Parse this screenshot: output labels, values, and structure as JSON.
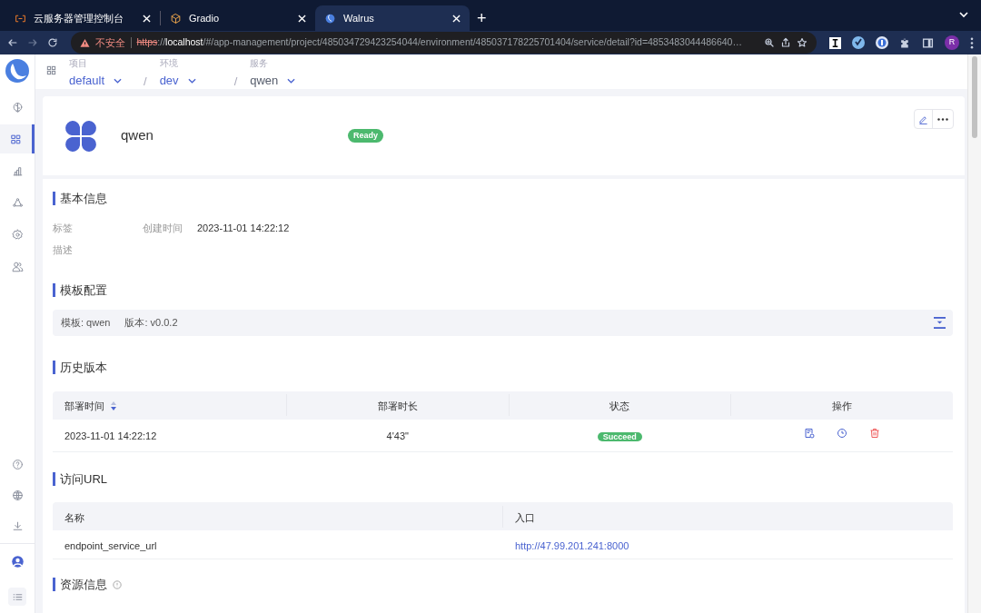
{
  "browser": {
    "tabs": [
      {
        "title": "云服务器管理控制台",
        "kind": "bracket",
        "selected": false
      },
      {
        "title": "Gradio",
        "kind": "cube",
        "selected": false
      },
      {
        "title": "Walrus",
        "kind": "moon",
        "selected": true
      }
    ],
    "new_tab": "+",
    "address": {
      "security": "不安全",
      "scheme": "https",
      "separator": "://",
      "host": "localhost",
      "path": "/#/app-management/project/485034729423254044/environment/485037178225701404/service/detail?id=4853483044486640…"
    },
    "profile": "R"
  },
  "sidebar": {
    "top_items": [
      {
        "kind": "brain",
        "selected": false
      },
      {
        "kind": "grid",
        "selected": true
      },
      {
        "kind": "chart",
        "selected": false
      },
      {
        "kind": "nodes",
        "selected": false
      },
      {
        "kind": "gear",
        "selected": false
      },
      {
        "kind": "users",
        "selected": false
      }
    ],
    "bottom_items": [
      {
        "kind": "help"
      },
      {
        "kind": "globe"
      },
      {
        "kind": "download"
      },
      {
        "kind": "avatar"
      },
      {
        "kind": "list"
      }
    ]
  },
  "breadcrumbs": [
    {
      "label": "项目",
      "value": "default",
      "current": false
    },
    {
      "label": "环境",
      "value": "dev",
      "current": false
    },
    {
      "label": "服务",
      "value": "qwen",
      "current": true
    }
  ],
  "breadcrumb_separator": "/",
  "service": {
    "name": "qwen",
    "status": "Ready"
  },
  "basic_info": {
    "title": "基本信息",
    "fields": [
      {
        "label": "标签"
      },
      {
        "label": "创建时间",
        "value": "2023-11-01 14:22:12"
      },
      {
        "label": "描述"
      }
    ]
  },
  "template": {
    "title": "模板配置",
    "items": [
      {
        "label": "模板:",
        "value": "qwen"
      },
      {
        "label": "版本:",
        "value": "v0.0.2"
      }
    ]
  },
  "history": {
    "title": "历史版本",
    "columns": [
      "部署时间",
      "部署时长",
      "状态",
      "操作"
    ],
    "rows": [
      {
        "time": "2023-11-01 14:22:12",
        "duration": "4'43\"",
        "status": "Succeed"
      }
    ]
  },
  "access": {
    "title": "访问URL",
    "columns": [
      "名称",
      "入口"
    ],
    "rows": [
      {
        "name": "endpoint_service_url",
        "url": "http://47.99.201.241:8000"
      }
    ]
  },
  "resources": {
    "title": "资源信息"
  }
}
